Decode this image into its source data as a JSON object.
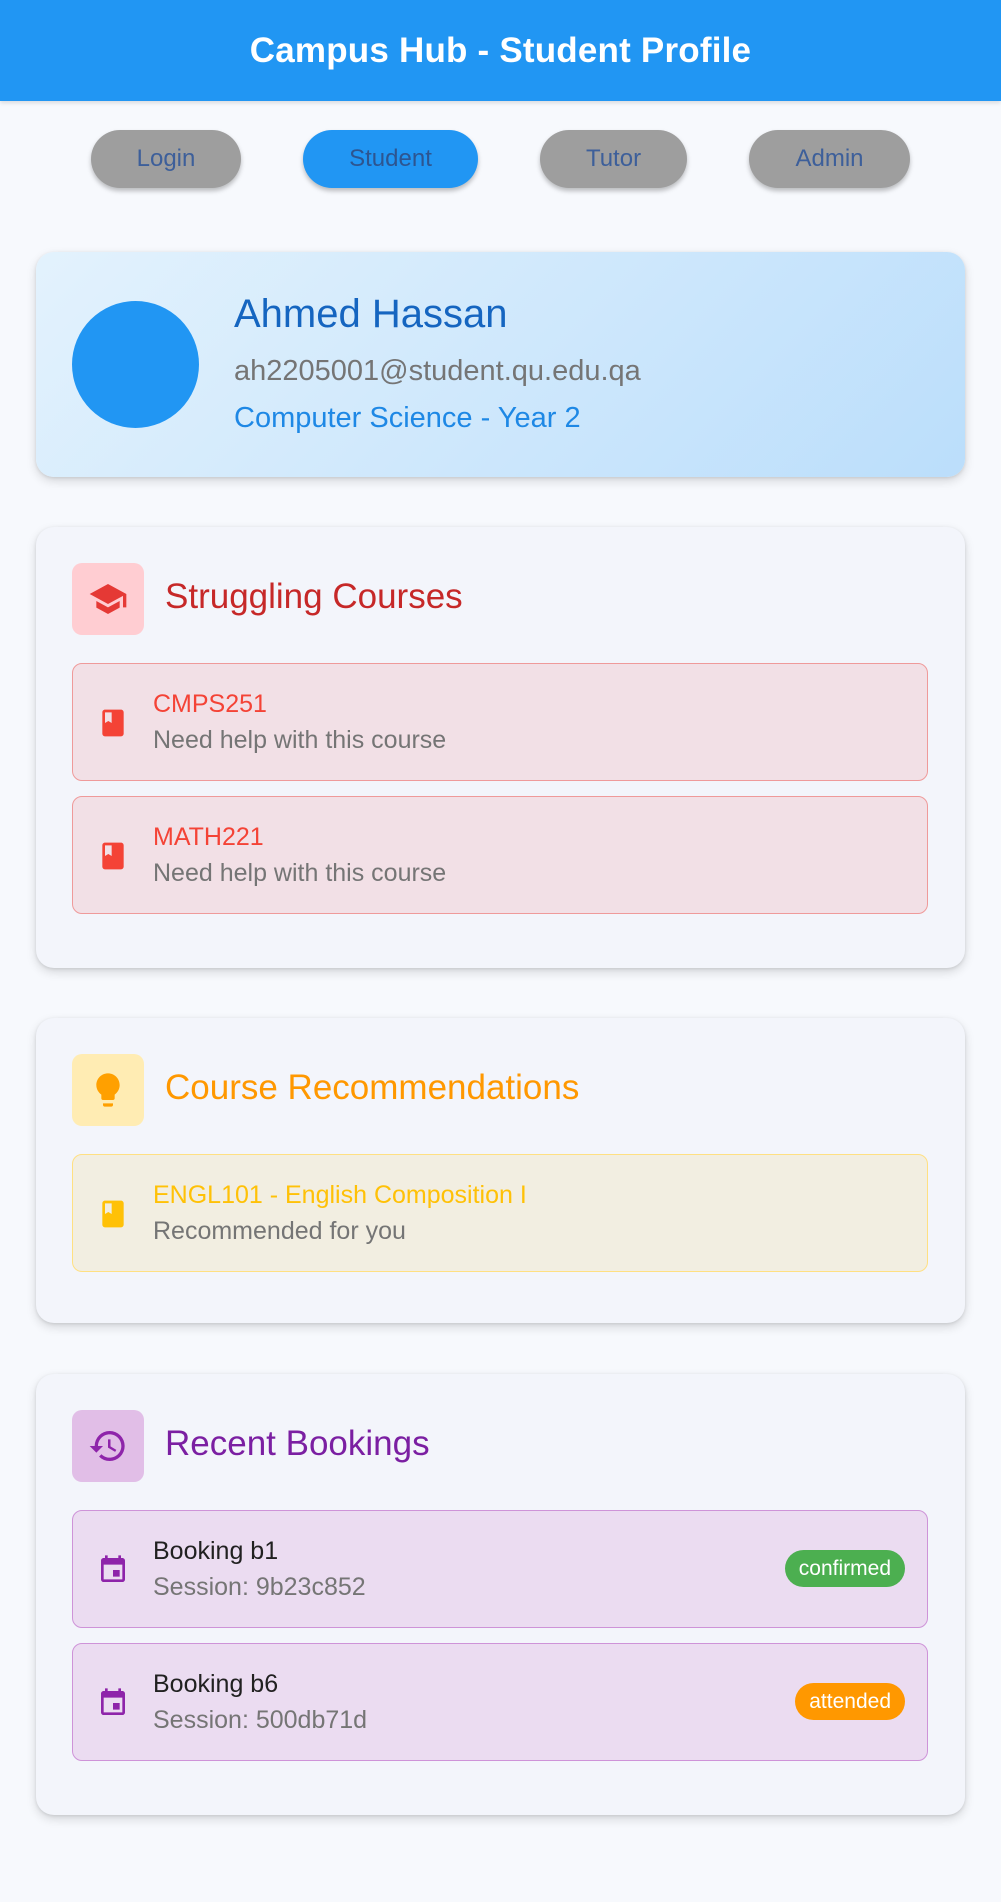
{
  "app": {
    "title": "Campus Hub - Student Profile"
  },
  "nav": {
    "items": [
      {
        "label": "Login",
        "active": false
      },
      {
        "label": "Student",
        "active": true
      },
      {
        "label": "Tutor",
        "active": false
      },
      {
        "label": "Admin",
        "active": false
      }
    ]
  },
  "profile": {
    "name": "Ahmed Hassan",
    "email": "ah2205001@student.qu.edu.qa",
    "program": "Computer Science - Year 2"
  },
  "struggling": {
    "title": "Struggling Courses",
    "icon": "school-icon",
    "items": [
      {
        "code": "CMPS251",
        "subtitle": "Need help with this course",
        "icon": "book-icon"
      },
      {
        "code": "MATH221",
        "subtitle": "Need help with this course",
        "icon": "book-icon"
      }
    ]
  },
  "recommendations": {
    "title": "Course Recommendations",
    "icon": "lightbulb-icon",
    "items": [
      {
        "title": "ENGL101 - English Composition I",
        "subtitle": "Recommended for you",
        "icon": "book-icon"
      }
    ]
  },
  "bookings": {
    "title": "Recent Bookings",
    "icon": "history-icon",
    "items": [
      {
        "title": "Booking b1",
        "session": "Session: 9b23c852",
        "status": "confirmed",
        "status_color": "#4caf50",
        "icon": "calendar-icon"
      },
      {
        "title": "Booking b6",
        "session": "Session: 500db71d",
        "status": "attended",
        "status_color": "#ff9800",
        "icon": "calendar-icon"
      }
    ]
  },
  "colors": {
    "primary": "#2196f3",
    "danger": "#f44336",
    "warning": "#ff9800",
    "accent_purple": "#7b1fa2"
  }
}
